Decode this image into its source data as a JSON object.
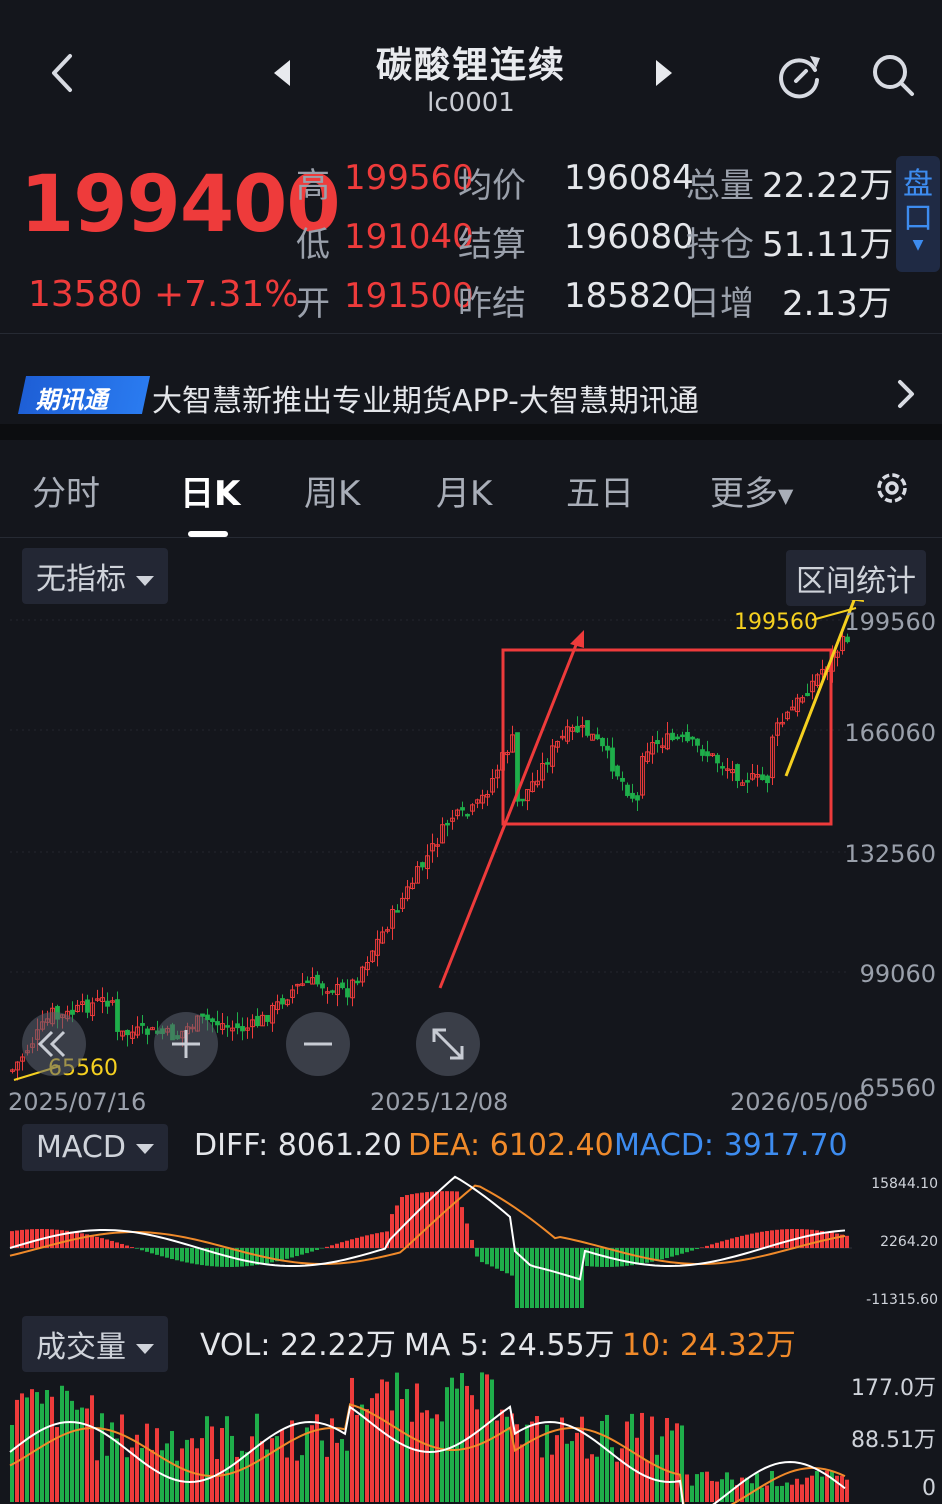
{
  "header": {
    "title": "碳酸锂连续",
    "code": "lc0001"
  },
  "quote": {
    "price": "199400",
    "change": "13580 +7.31%",
    "rows": [
      {
        "l1": "高",
        "v1": "199560",
        "l2": "均价",
        "v2": "196084",
        "l3": "总量",
        "v3": "22.22万"
      },
      {
        "l1": "低",
        "v1": "191040",
        "l2": "结算",
        "v2": "196080",
        "l3": "持仓",
        "v3": "51.11万"
      },
      {
        "l1": "开",
        "v1": "191500",
        "l2": "昨结",
        "v2": "185820",
        "l3": "日增",
        "v3": "2.13万"
      }
    ],
    "pankou_label": "盘口"
  },
  "ad": {
    "badge": "期讯通",
    "text": "大智慧新推出专业期货APP-大智慧期讯通"
  },
  "tabs": [
    {
      "label": "分时"
    },
    {
      "label": "日K"
    },
    {
      "label": "周K"
    },
    {
      "label": "月K"
    },
    {
      "label": "五日"
    },
    {
      "label": "更多"
    }
  ],
  "indicator": {
    "selector": "无指标",
    "range_stats": "区间统计"
  },
  "kchart": {
    "y_ticks": [
      "199560",
      "166060",
      "132560",
      "99060",
      "65560"
    ],
    "x_ticks": [
      "2025/07/16",
      "2025/12/08",
      "2026/05/06"
    ],
    "high_label": "199560",
    "low_label": "65560"
  },
  "macd": {
    "selector": "MACD",
    "diff": "DIFF: 8061.20",
    "dea": "DEA: 6102.40",
    "macd": "MACD: 3917.70",
    "ticks": [
      "15844.10",
      "2264.20",
      "-11315.60"
    ]
  },
  "volume": {
    "selector": "成交量",
    "vol": "VOL: 22.22万",
    "ma5": "MA 5: 24.55万",
    "ma10": "10: 24.32万",
    "ticks": [
      "177.0万",
      "88.51万",
      "0"
    ]
  },
  "colors": {
    "up": "#ee3b3b",
    "down": "#1fae4a",
    "dea": "#f08a2a",
    "macd": "#3d8cf0",
    "annotation": "#f5d020"
  }
}
